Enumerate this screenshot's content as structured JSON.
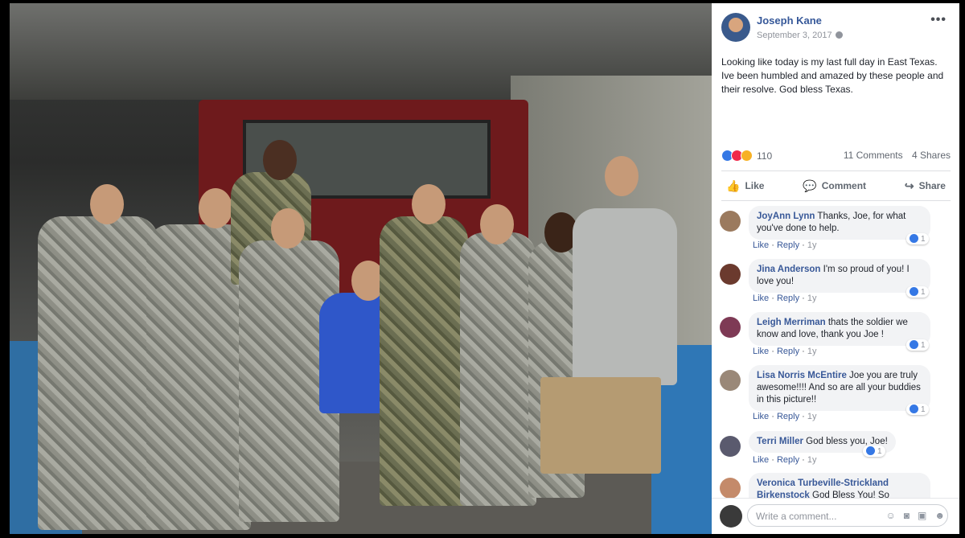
{
  "post": {
    "author": "Joseph Kane",
    "date": "September 3, 2017",
    "text": "Looking like today is my last full day in East Texas. Ive been humbled and amazed by these people and their resolve. God bless Texas.",
    "reactions_count": "110",
    "comments_count": "11 Comments",
    "shares_count": "4 Shares"
  },
  "actions": {
    "like": "Like",
    "comment": "Comment",
    "share": "Share"
  },
  "comments": [
    {
      "name": "JoyAnn Lynn",
      "text": "Thanks, Joe, for what you've done to help.",
      "like": "Like",
      "reply": "Reply",
      "time": "1y",
      "likes": "1"
    },
    {
      "name": "Jina Anderson",
      "text": "I'm so proud of you! I love you!",
      "like": "Like",
      "reply": "Reply",
      "time": "1y",
      "likes": "1"
    },
    {
      "name": "Leigh Merriman",
      "text": "thats the soldier we know and love, thank you Joe !",
      "like": "Like",
      "reply": "Reply",
      "time": "1y",
      "likes": "1"
    },
    {
      "name": "Lisa Norris McEntire",
      "text": "Joe you are truly awesome!!!! And so are all your buddies in this picture!!",
      "like": "Like",
      "reply": "Reply",
      "time": "1y",
      "likes": "1"
    },
    {
      "name": "Terri Miller",
      "text": "God bless you, Joe!",
      "like": "Like",
      "reply": "Reply",
      "time": "1y",
      "likes": "1"
    },
    {
      "name": "Veronica Turbeville-Strickland Birkenstock",
      "text": "God Bless You! So grateful"
    }
  ],
  "composer": {
    "placeholder": "Write a comment..."
  },
  "colors": {
    "link": "#385898",
    "like_blue": "#3578e5"
  }
}
